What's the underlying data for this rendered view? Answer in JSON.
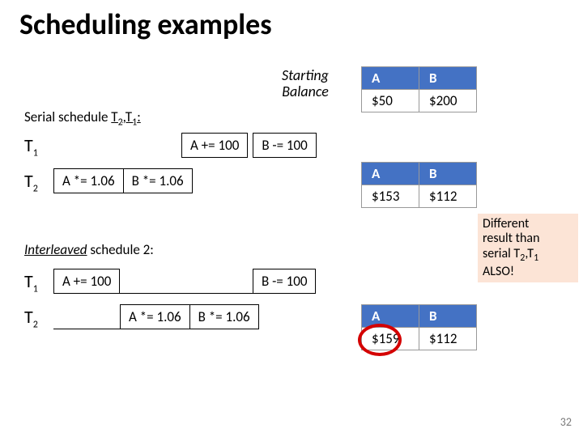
{
  "title": "Scheduling examples",
  "starting_balance_label_1": "Starting",
  "starting_balance_label_2": "Balance",
  "headers": {
    "A": "A",
    "B": "B"
  },
  "start": {
    "A": "$50",
    "B": "$200"
  },
  "serial_label_prefix": "Serial schedule ",
  "serial_label_order": "T",
  "serial_label_order2": ",T",
  "serial_label_colon": ":",
  "serial_sub1": "2",
  "serial_sub2": "1",
  "t_label": "T",
  "sub1": "1",
  "sub2": "2",
  "ops": {
    "a_plus": "A += 100",
    "b_minus": "B -= 100",
    "a_mul": "A *= 1.06",
    "b_mul": "B *= 1.06"
  },
  "serial_result": {
    "A": "$153",
    "B": "$112"
  },
  "inter_label_word": "Interleaved",
  "inter_label_rest": " schedule 2:",
  "inter_result": {
    "A": "$159",
    "B": "$112"
  },
  "note_l1": "Different",
  "note_l2": "result than",
  "note_l3": "serial T",
  "note_l3b": ",T",
  "note_l4": "ALSO!",
  "slide_num": "32"
}
